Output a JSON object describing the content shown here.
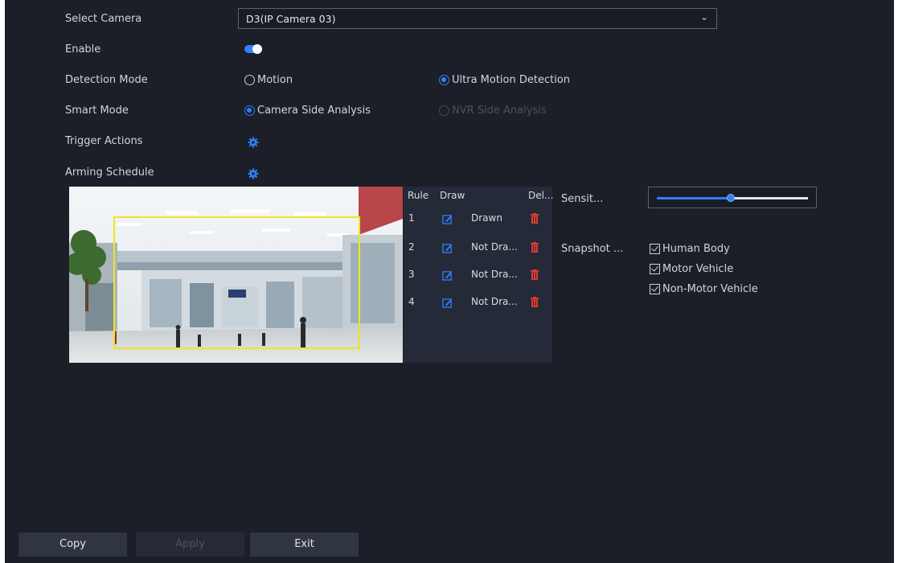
{
  "form": {
    "select_camera": {
      "label": "Select Camera",
      "value": "D3(IP Camera 03)"
    },
    "enable": {
      "label": "Enable",
      "on": true
    },
    "detection_mode": {
      "label": "Detection Mode",
      "options": [
        "Motion",
        "Ultra Motion Detection"
      ],
      "selected": "Ultra Motion Detection"
    },
    "smart_mode": {
      "label": "Smart Mode",
      "options": [
        "Camera Side Analysis",
        "NVR Side Analysis"
      ],
      "selected": "Camera Side Analysis",
      "disabled": "NVR Side Analysis"
    },
    "trigger_actions": {
      "label": "Trigger Actions",
      "icon": "gear-icon"
    },
    "arming_schedule": {
      "label": "Arming Schedule",
      "icon": "gear-icon"
    }
  },
  "rules_table": {
    "headers": [
      "Rule",
      "Draw",
      "Del..."
    ],
    "rows": [
      {
        "rule": "1",
        "status": "Drawn"
      },
      {
        "rule": "2",
        "status": "Not Dra..."
      },
      {
        "rule": "3",
        "status": "Not Dra..."
      },
      {
        "rule": "4",
        "status": "Not Dra..."
      }
    ]
  },
  "sensitivity": {
    "label": "Sensit...",
    "level_fraction": 0.49
  },
  "snapshot": {
    "label": "Snapshot ...",
    "options": [
      {
        "label": "Human Body",
        "checked": true
      },
      {
        "label": "Motor Vehicle",
        "checked": true
      },
      {
        "label": "Non-Motor Vehicle",
        "checked": true
      }
    ]
  },
  "buttons": {
    "copy": "Copy",
    "apply": "Apply",
    "exit": "Exit"
  },
  "colors": {
    "accent": "#2f7fff",
    "delete": "#e23a2f",
    "region": "#f1e61b",
    "background": "#1c1e28"
  }
}
